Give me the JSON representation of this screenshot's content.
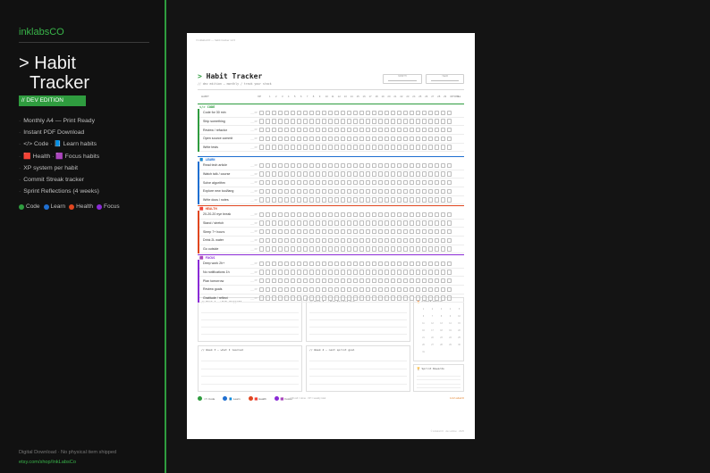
{
  "sidebar": {
    "brand": "inklabsCO",
    "title_line1": "> Habit",
    "title_line2": "Tracker",
    "edition": "// DEV EDITION",
    "features": [
      "Monthly A4 — Print Ready",
      "Instant PDF Download",
      "</> Code · 📘 Learn habits",
      "🟥 Health · 🟪 Focus habits",
      "XP system per habit",
      "Commit Streak tracker",
      "Sprint Reflections (4 weeks)"
    ],
    "legend": [
      {
        "label": "Code",
        "color": "#2f9c3f"
      },
      {
        "label": "Learn",
        "color": "#1f6fd1"
      },
      {
        "label": "Health",
        "color": "#e0461f"
      },
      {
        "label": "Focus",
        "color": "#8a2bd6"
      }
    ],
    "footer_note": "Digital Download · No physical item shipped",
    "footer_link": "etsy.com/shop/InkLabsCo"
  },
  "paper": {
    "top_text": "// inklabsCO — habit tracker v2.0",
    "title_arrow": ">",
    "title": "Habit Tracker",
    "subtitle": "// dev edition — monthly / track your stack",
    "month_label": "MONTH",
    "year_label": "YEAR",
    "habit_col": "HABIT",
    "xp_col": "XP",
    "total_col": "TOTAL",
    "days": [
      "1",
      "2",
      "3",
      "4",
      "5",
      "6",
      "7",
      "8",
      "9",
      "10",
      "11",
      "12",
      "13",
      "14",
      "15",
      "16",
      "17",
      "18",
      "19",
      "20",
      "21",
      "22",
      "23",
      "24",
      "25",
      "26",
      "27",
      "28",
      "29",
      "30",
      "31"
    ],
    "sections": [
      {
        "title": "</> CODE",
        "color": "#2f9c3f",
        "habits": [
          "Code for 30 min",
          "Ship something",
          "Review / refactor",
          "Open source commit",
          "Write tests"
        ]
      },
      {
        "title": "📘 LEARN",
        "color": "#1f6fd1",
        "habits": [
          "Read tech article",
          "Watch talk / course",
          "Solve algorithm",
          "Explore new tool/lang",
          "Write docs / notes"
        ]
      },
      {
        "title": "🟥 HEALTH",
        "color": "#e0461f",
        "habits": [
          "20-20-20 eye break",
          "Stand / stretch",
          "Sleep 7+ hours",
          "Drink 2L water",
          "Go outside"
        ]
      },
      {
        "title": "🟪 FOCUS",
        "color": "#8a2bd6",
        "habits": [
          "Deep work 2h+",
          "No notifications 1h",
          "Plan tomorrow",
          "Review goals",
          "Gratitude / reflect"
        ]
      }
    ],
    "xp_placeholder": "___XP",
    "reflections": [
      "// Week 1 — what shipped?",
      "// Week 2 — what blocked me?",
      "// Week 3 — what I learned",
      "// Week 4 — next sprint goal"
    ],
    "streak_title": "🔥 Commit Streak",
    "sprint_title": "🏆 Sprint Rewards",
    "legend": [
      {
        "label": "</> Code",
        "color": "#2f9c3f"
      },
      {
        "label": "📘 Learn",
        "color": "#1f6fd1"
      },
      {
        "label": "🟥 Health",
        "color": "#e0461f"
      },
      {
        "label": "🟪 Focus",
        "color": "#8a2bd6"
      }
    ],
    "legend_note": "// fill cell = done · XP = weekly total",
    "brand": "inklabsCO",
    "footer": "© inklabsCO · dev edition · 2025"
  }
}
